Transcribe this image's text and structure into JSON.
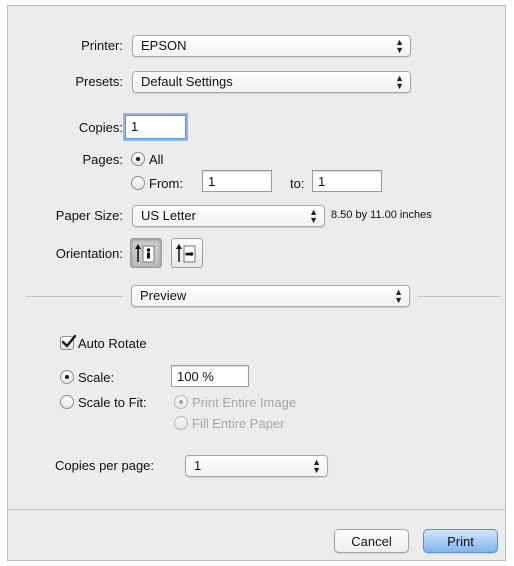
{
  "printer": {
    "label": "Printer:",
    "value": "EPSON"
  },
  "presets": {
    "label": "Presets:",
    "value": "Default Settings"
  },
  "copies": {
    "label": "Copies:",
    "value": "1"
  },
  "pages": {
    "label": "Pages:",
    "all_label": "All",
    "from_label": "From:",
    "from_value": "1",
    "to_label": "to:",
    "to_value": "1",
    "selected": "All"
  },
  "paper_size": {
    "label": "Paper Size:",
    "value": "US Letter",
    "dimensions": "8.50 by 11.00 inches"
  },
  "orientation": {
    "label": "Orientation:",
    "selected": "portrait"
  },
  "section_popup": {
    "value": "Preview"
  },
  "auto_rotate": {
    "label": "Auto Rotate",
    "checked": true
  },
  "scale": {
    "label": "Scale:",
    "value": "100 %",
    "selected": true
  },
  "scale_to_fit": {
    "label": "Scale to Fit:",
    "print_entire_image": "Print Entire Image",
    "fill_entire_paper": "Fill Entire Paper"
  },
  "copies_per_page": {
    "label": "Copies per page:",
    "value": "1"
  },
  "buttons": {
    "cancel": "Cancel",
    "print": "Print"
  },
  "colors": {
    "dialog_bg": "#ececec",
    "default_button": "#83b4ee",
    "focus_ring": "#8db9ea"
  }
}
